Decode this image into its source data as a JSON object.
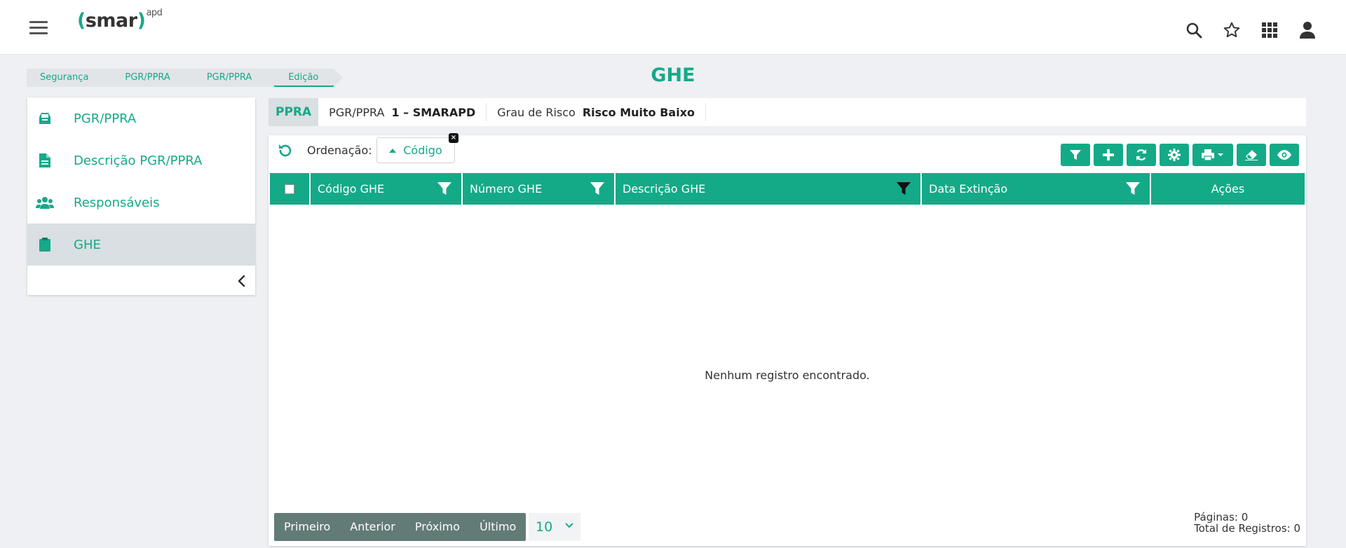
{
  "header": {
    "logo_open": "(",
    "logo_text": "smar",
    "logo_close": ")",
    "logo_super": "apd",
    "icons": [
      "search-icon",
      "star-icon",
      "apps-grid-icon",
      "user-icon"
    ]
  },
  "breadcrumb": [
    "Segurança",
    "PGR/PPRA",
    "PGR/PPRA",
    "Edição"
  ],
  "page_title": "GHE",
  "sidebar": {
    "items": [
      {
        "label": "PGR/PPRA",
        "icon": "inbox-icon"
      },
      {
        "label": "Descrição PGR/PPRA",
        "icon": "document-icon"
      },
      {
        "label": "Responsáveis",
        "icon": "users-icon"
      },
      {
        "label": "GHE",
        "icon": "clipboard-icon",
        "active": true
      }
    ]
  },
  "infobar": {
    "tag": "PPRA",
    "field1_label": "PGR/PPRA",
    "field1_value": "1 – SMARAPD",
    "field2_label": "Grau de Risco",
    "field2_value": "Risco Muito Baixo"
  },
  "ordering": {
    "label": "Ordenação:",
    "chip": "Código",
    "chip_close": "×"
  },
  "toolbar": [
    "filter-icon",
    "plus-icon",
    "refresh-icon",
    "gear-icon",
    "print-icon",
    "eraser-icon",
    "eye-icon"
  ],
  "table": {
    "columns": [
      "Código GHE",
      "Número GHE",
      "Descrição GHE",
      "Data Extinção",
      "Ações"
    ],
    "empty_message": "Nenhum registro encontrado."
  },
  "pagination": {
    "first": "Primeiro",
    "previous": "Anterior",
    "next": "Próximo",
    "last": "Último",
    "page_size": "10",
    "pages": "Páginas: 0",
    "total": "Total de Registros: 0"
  },
  "colors": {
    "accent": "#16a98a",
    "header_bg": "#14aa87",
    "pager_bg": "#637b76"
  }
}
